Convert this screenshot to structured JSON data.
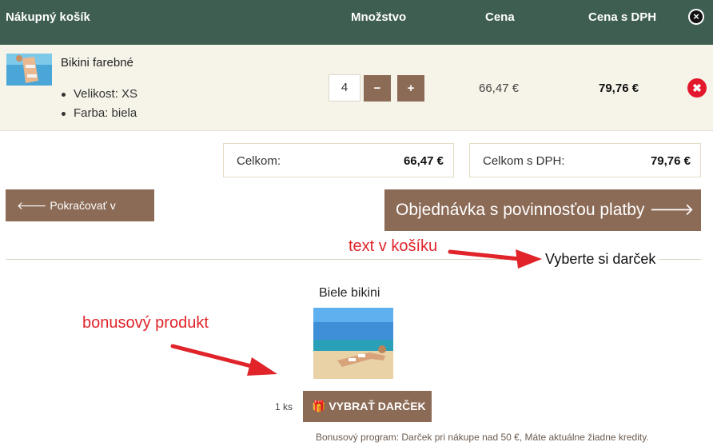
{
  "header": {
    "title": "Nákupný košík",
    "qty": "Množstvo",
    "price": "Cena",
    "price_vat": "Cena s DPH",
    "close_icon": "×"
  },
  "item": {
    "name": "Bikini farebné",
    "size": "Velikost: XS",
    "color": "Farba: biela",
    "qty": "4",
    "minus": "−",
    "plus": "+",
    "price": "66,47 €",
    "price_vat": "79,76 €",
    "remove_icon": "✖"
  },
  "totals": {
    "label": "Celkom:",
    "value": "66,47 €",
    "label_vat": "Celkom s DPH:",
    "value_vat": "79,76 €"
  },
  "actions": {
    "continue": "🡐 Pokračovať v nákupe",
    "order": "Objednávka s povinnosťou platby 🡒"
  },
  "annotations": {
    "cart_text": "text v košíku",
    "bonus_product": "bonusový produkt"
  },
  "gift": {
    "section_title": "Vyberte si darček",
    "product_name": "Biele bikini",
    "qty": "1 ks",
    "button": "🎁 VYBRAŤ DARČEK",
    "note": "Bonusový program: Darček pri nákupe nad 50 €, Máte aktuálne žiadne kredity."
  },
  "colors": {
    "header": "#3e5e51",
    "button": "#8b6a56",
    "row": "#f6f3e8",
    "annotation": "#e0242a"
  }
}
